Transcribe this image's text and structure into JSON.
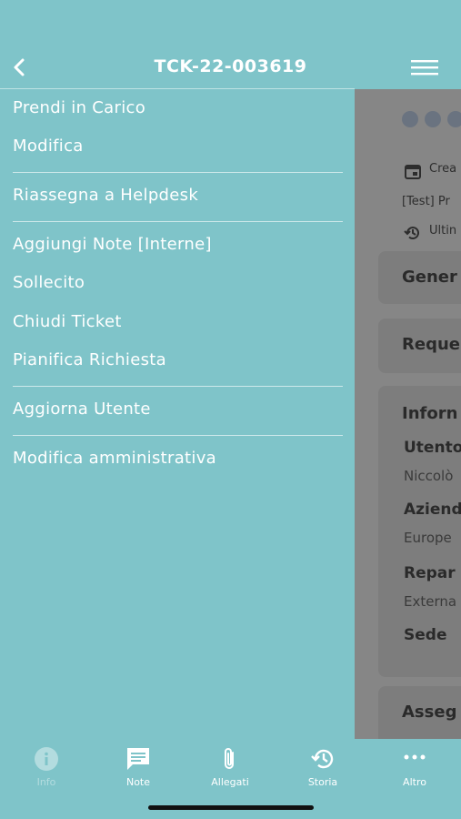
{
  "header": {
    "title": "TCK-22-003619"
  },
  "menu": {
    "items": [
      "Prendi in Carico",
      "Modifica",
      "Riassegna a Helpdesk",
      "Aggiungi Note [Interne]",
      "Sollecito",
      "Chiudi Ticket",
      "Pianifica Richiesta",
      "Aggiorna Utente",
      "Modifica amministrativa"
    ]
  },
  "background": {
    "created": "Crea",
    "subject": "[Test] Pr",
    "last": "Ultin",
    "section_general": "Gener",
    "section_request": "Reque",
    "section_info": "Inforn",
    "user_label": "Utento",
    "user_value": "Niccolò",
    "company_label": "Aziend",
    "company_value": "Europe",
    "dept_label": "Repar",
    "dept_value": "Externa",
    "site_label": "Sede",
    "section_assign": "Asseg"
  },
  "tabs": [
    {
      "label": "Info",
      "icon": "info-icon",
      "active": true
    },
    {
      "label": "Note",
      "icon": "chat-icon",
      "active": false
    },
    {
      "label": "Allegati",
      "icon": "paperclip-icon",
      "active": false
    },
    {
      "label": "Storia",
      "icon": "history-icon",
      "active": false
    },
    {
      "label": "Altro",
      "icon": "more-icon",
      "active": false
    }
  ],
  "colors": {
    "primary": "#7fc4c9",
    "overlay": "#868686",
    "active_tab": "#b3dcdf"
  }
}
